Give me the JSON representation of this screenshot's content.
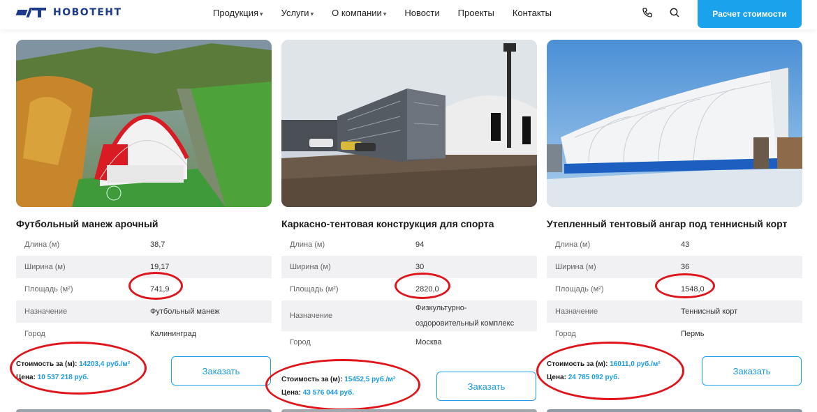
{
  "header": {
    "logo_text": "НОВОТЕНТ",
    "nav": [
      {
        "label": "Продукция",
        "caret": "▾"
      },
      {
        "label": "Услуги",
        "caret": "▾"
      },
      {
        "label": "О компании",
        "caret": "▾"
      },
      {
        "label": "Новости",
        "caret": ""
      },
      {
        "label": "Проекты",
        "caret": ""
      },
      {
        "label": "Контакты",
        "caret": ""
      }
    ],
    "phone_icon": "phone-icon",
    "search_icon": "search-icon",
    "cta_label": "Расчет стоимости"
  },
  "colors": {
    "accent": "#1aa3ec",
    "brand": "#1e3a8a",
    "annotation": "#e0141b"
  },
  "cards": [
    {
      "title": "Футбольный манеж арочный",
      "specs": [
        {
          "key": "Длина (м)",
          "value": "38,7"
        },
        {
          "key": "Ширина (м)",
          "value": "19,17"
        },
        {
          "key": "Площадь (м²)",
          "value": "741,9"
        },
        {
          "key": "Назначение",
          "value": "Футбольный манеж"
        },
        {
          "key": "Город",
          "value": "Калининград"
        }
      ],
      "cost_label": "Стоимость за (м):",
      "cost_value": "14203,4 руб./м²",
      "price_label": "Цена:",
      "price_value": "10 537 218 руб.",
      "order_label": "Заказать"
    },
    {
      "title": "Каркасно-тентовая конструкция для спорта",
      "specs": [
        {
          "key": "Длина (м)",
          "value": "94"
        },
        {
          "key": "Ширина (м)",
          "value": "30"
        },
        {
          "key": "Площадь (м²)",
          "value": "2820,0"
        },
        {
          "key": "Назначение",
          "value": "Физкультурно-оздоровительный комплекс"
        },
        {
          "key": "Город",
          "value": "Москва"
        }
      ],
      "cost_label": "Стоимость за (м):",
      "cost_value": "15452,5 руб./м²",
      "price_label": "Цена:",
      "price_value": "43 576 044 руб.",
      "order_label": "Заказать"
    },
    {
      "title": "Утепленный тентовый ангар под теннисный корт",
      "specs": [
        {
          "key": "Длина (м)",
          "value": "43"
        },
        {
          "key": "Ширина (м)",
          "value": "36"
        },
        {
          "key": "Площадь (м²)",
          "value": "1548,0"
        },
        {
          "key": "Назначение",
          "value": "Теннисный корт"
        },
        {
          "key": "Город",
          "value": "Пермь"
        }
      ],
      "cost_label": "Стоимость за (м):",
      "cost_value": "16011,0 руб./м²",
      "price_label": "Цена:",
      "price_value": "24 785 092 руб.",
      "order_label": "Заказать"
    }
  ]
}
